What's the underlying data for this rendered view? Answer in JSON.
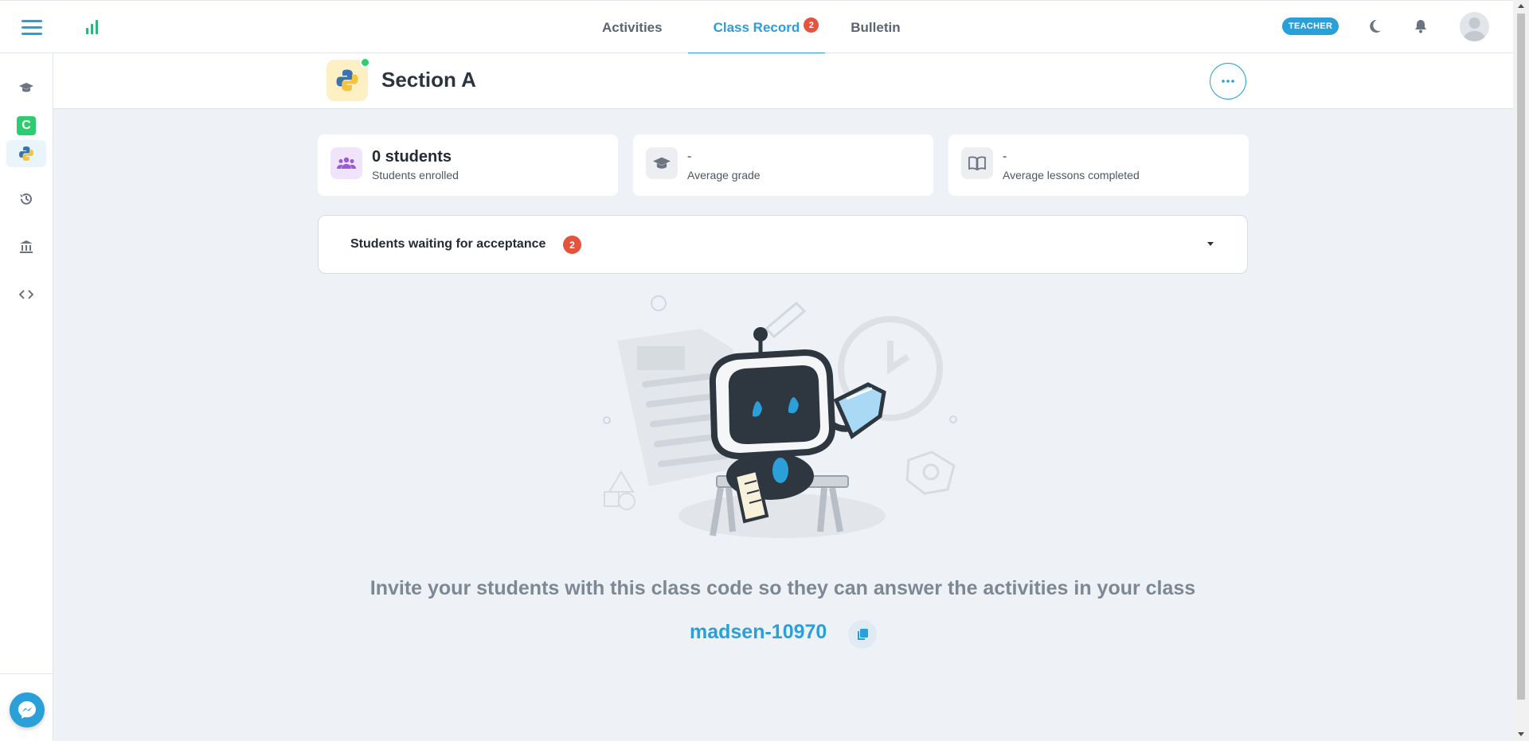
{
  "topbar": {
    "tabs": [
      {
        "label": "Activities",
        "active": false
      },
      {
        "label": "Class Record",
        "active": true,
        "badge": "2"
      },
      {
        "label": "Bulletin",
        "active": false
      }
    ],
    "role_badge": "TEACHER",
    "icons": [
      "menu-icon",
      "stats-icon",
      "moon-icon",
      "bell-icon",
      "user-avatar-icon"
    ]
  },
  "sidebar": {
    "items": [
      {
        "icon": "graduation-cap-icon"
      },
      {
        "icon": "c-course-icon",
        "letter": "C"
      },
      {
        "icon": "python-icon",
        "active": true
      },
      {
        "icon": "history-icon"
      },
      {
        "icon": "institution-icon"
      },
      {
        "icon": "code-icon"
      }
    ],
    "chat_icon": "messenger-icon"
  },
  "section": {
    "title": "Section A",
    "logo": "python-icon",
    "more_icon": "ellipsis-icon"
  },
  "cards": [
    {
      "value": "0 students",
      "label": "Students enrolled",
      "icon": "users-icon"
    },
    {
      "value": "-",
      "label": "Average grade",
      "icon": "graduation-cap-icon"
    },
    {
      "value": "-",
      "label": "Average lessons completed",
      "icon": "book-icon"
    }
  ],
  "waiting": {
    "title": "Students waiting for acceptance",
    "count": "2"
  },
  "invite": {
    "text": "Invite your students with this class code so they can answer the activities in your class",
    "code": "madsen-10970",
    "copy_icon": "copy-icon"
  },
  "colors": {
    "accent": "#2a9fd8",
    "badge": "#e5533d",
    "online": "#2ecc71",
    "background": "#eef2f6"
  }
}
